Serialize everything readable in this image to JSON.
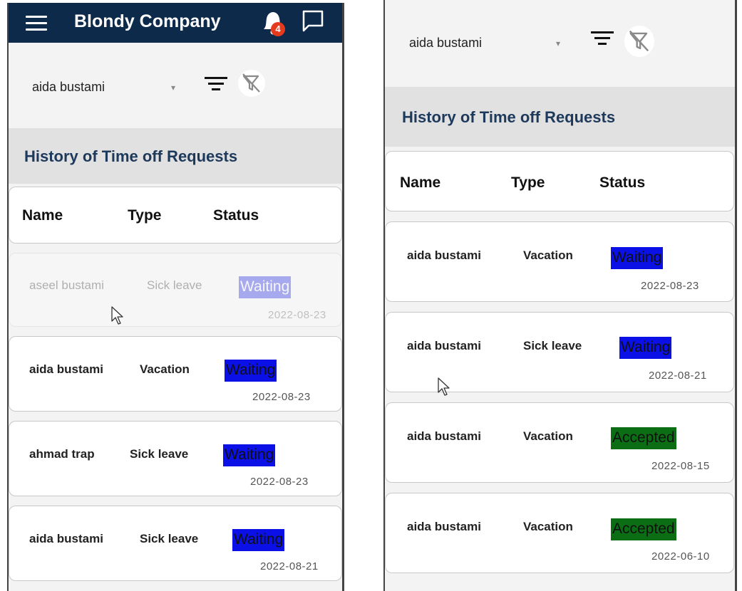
{
  "app": {
    "title": "Blondy Company",
    "notification_count": "4"
  },
  "colors": {
    "appbar": "#0d2a4a",
    "waiting": "#0a10e6",
    "accepted": "#0c6e14",
    "badge": "#e53a1e",
    "section_title": "#1d3a5c"
  },
  "filter": {
    "selected_user": "aida bustami"
  },
  "section_title": "History of Time off Requests",
  "table": {
    "headers": [
      "Name",
      "Type",
      "Status"
    ]
  },
  "left": {
    "requests": [
      {
        "name": "aseel bustami",
        "type": "Sick leave",
        "status": "Waiting",
        "date": "2022-08-23"
      },
      {
        "name": "aida bustami",
        "type": "Vacation",
        "status": "Waiting",
        "date": "2022-08-23"
      },
      {
        "name": "ahmad trap",
        "type": "Sick leave",
        "status": "Waiting",
        "date": "2022-08-23"
      },
      {
        "name": "aida bustami",
        "type": "Sick leave",
        "status": "Waiting",
        "date": "2022-08-21"
      }
    ]
  },
  "right": {
    "requests": [
      {
        "name": "aida bustami",
        "type": "Vacation",
        "status": "Waiting",
        "date": "2022-08-23"
      },
      {
        "name": "aida bustami",
        "type": "Sick leave",
        "status": "Waiting",
        "date": "2022-08-21"
      },
      {
        "name": "aida bustami",
        "type": "Vacation",
        "status": "Accepted",
        "date": "2022-08-15"
      },
      {
        "name": "aida bustami",
        "type": "Vacation",
        "status": "Accepted",
        "date": "2022-06-10"
      }
    ]
  }
}
